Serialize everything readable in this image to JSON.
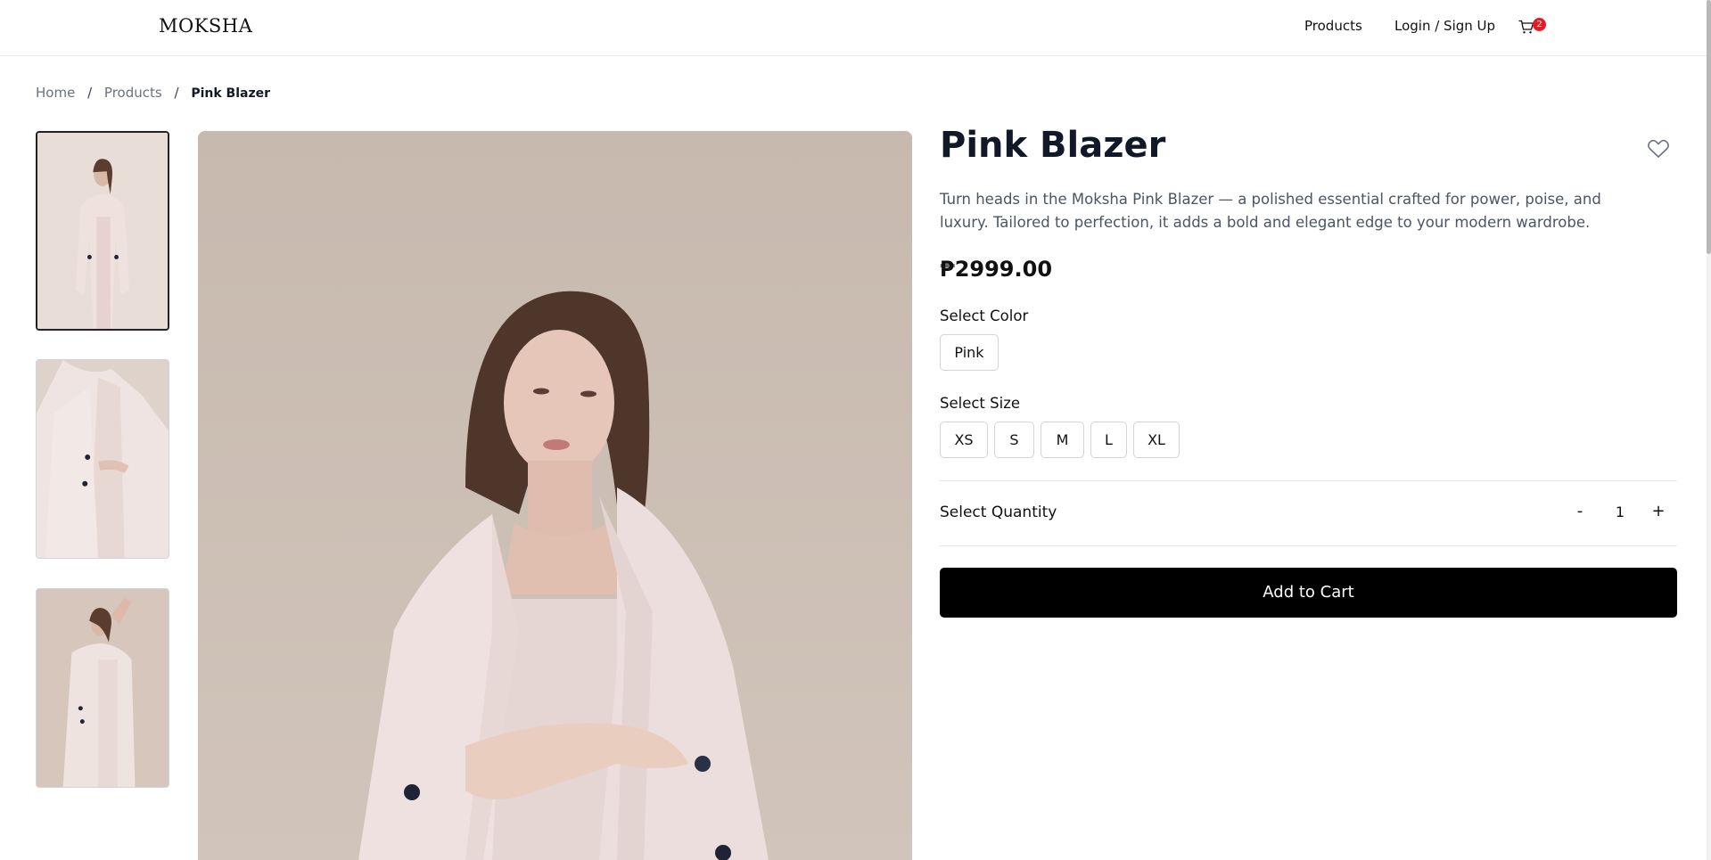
{
  "header": {
    "logo": "MOKSHA",
    "nav": {
      "products": "Products",
      "login": "Login / Sign Up"
    },
    "cart_count": "2"
  },
  "breadcrumb": {
    "home": "Home",
    "products": "Products",
    "current": "Pink Blazer",
    "separator": "/"
  },
  "product": {
    "title": "Pink Blazer",
    "description": "Turn heads in the Moksha Pink Blazer — a polished essential crafted for power, poise, and luxury. Tailored to perfection, it adds a bold and elegant edge to your modern wardrobe.",
    "price": "₱2999.00",
    "select_color_label": "Select Color",
    "colors": [
      "Pink"
    ],
    "select_size_label": "Select Size",
    "sizes": [
      "XS",
      "S",
      "M",
      "L",
      "XL"
    ],
    "select_quantity_label": "Select Quantity",
    "quantity": "1",
    "decrement": "-",
    "increment": "+",
    "add_to_cart": "Add to Cart"
  },
  "gallery": {
    "thumbnail_count": 3,
    "active_thumbnail": 0
  },
  "colors": {
    "accent": "#000000",
    "badge": "#e11d2a",
    "text_muted": "#4b5563"
  }
}
